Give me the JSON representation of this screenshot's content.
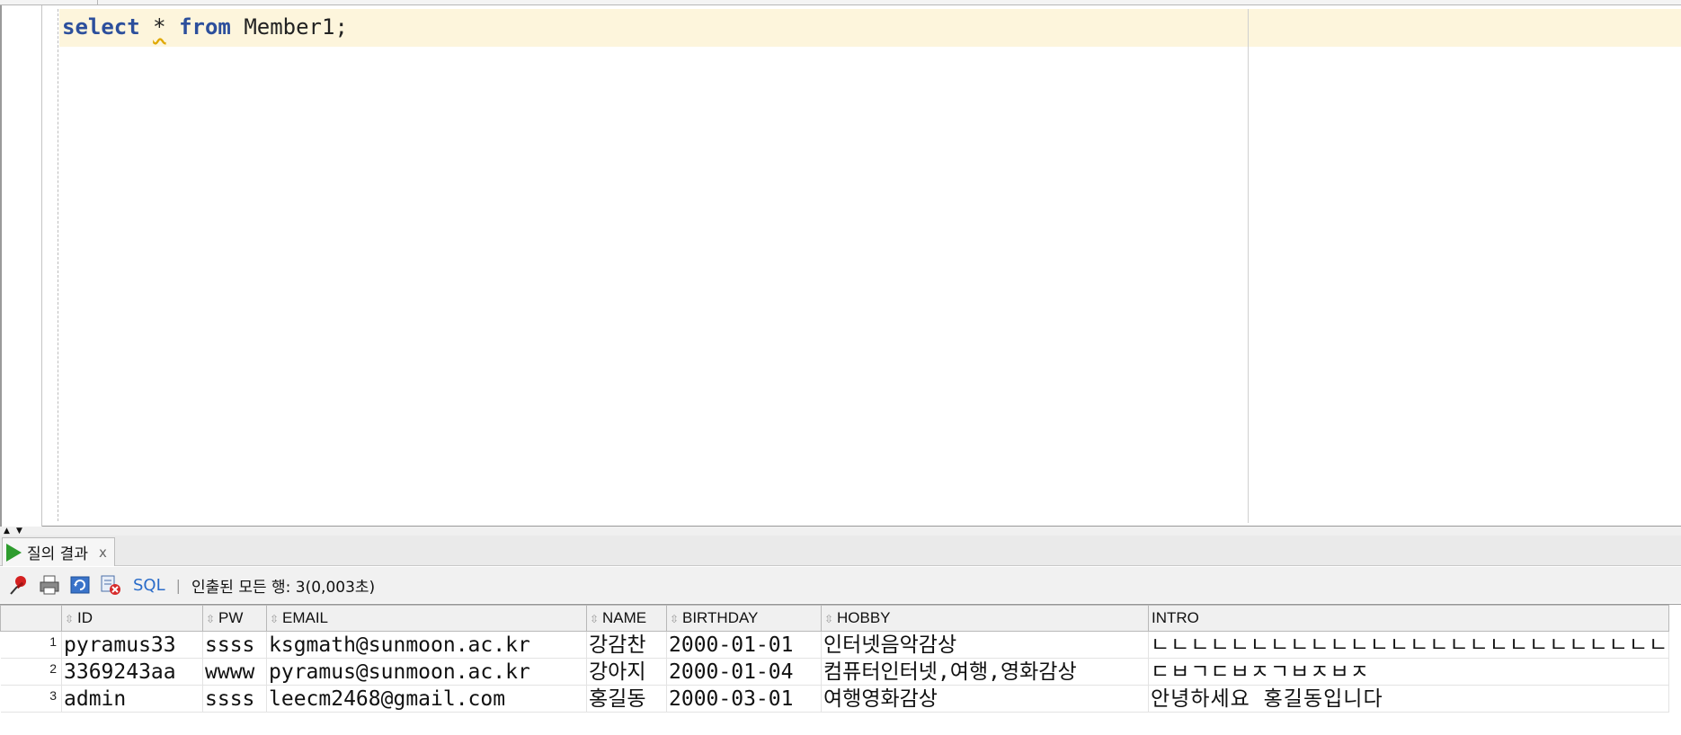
{
  "editor": {
    "code": {
      "kw_select": "select",
      "star": "*",
      "kw_from": "from",
      "rest": "Member1;"
    }
  },
  "results": {
    "tab_label": "질의 결과",
    "tab_close": "x",
    "toolbar": {
      "sql_label": "SQL",
      "separator": "|",
      "status": "인출된 모든 행: 3(0,003초)"
    },
    "columns": [
      "ID",
      "PW",
      "EMAIL",
      "NAME",
      "BIRTHDAY",
      "HOBBY",
      "INTRO"
    ],
    "rows": [
      {
        "num": "1",
        "ID": "pyramus33",
        "PW": "ssss",
        "EMAIL": "ksgmath@sunmoon.ac.kr",
        "NAME": "강감찬",
        "BIRTHDAY": "2000-01-01",
        "HOBBY": "인터넷음악감상",
        "INTRO": "ㄴㄴㄴㄴㄴㄴㄴㄴㄴㄴㄴㄴㄴㄴㄴㄴㄴㄴㄴㄴㄴㄴㄴㄴㄴㄴ"
      },
      {
        "num": "2",
        "ID": "3369243aa",
        "PW": "wwww",
        "EMAIL": "pyramus@sunmoon.ac.kr",
        "NAME": "강아지",
        "BIRTHDAY": "2000-01-04",
        "HOBBY": "컴퓨터인터넷,여행,영화감상",
        "INTRO": "ㄷㅂㄱㄷㅂㅈㄱㅂㅈㅂㅈ"
      },
      {
        "num": "3",
        "ID": "admin",
        "PW": "ssss",
        "EMAIL": "leecm2468@gmail.com",
        "NAME": "홍길동",
        "BIRTHDAY": "2000-03-01",
        "HOBBY": "여행영화감상",
        "INTRO": "안녕하세요 홍길동입니다"
      }
    ]
  },
  "icons": [
    "pin-icon",
    "print-icon",
    "refresh-icon",
    "delete-query-icon",
    "run-icon"
  ],
  "colors": {
    "keyword": "#2c4f9c",
    "current_line": "#fdf5dc",
    "run_green": "#2e9c2e",
    "sql_link": "#2a6cc9"
  }
}
